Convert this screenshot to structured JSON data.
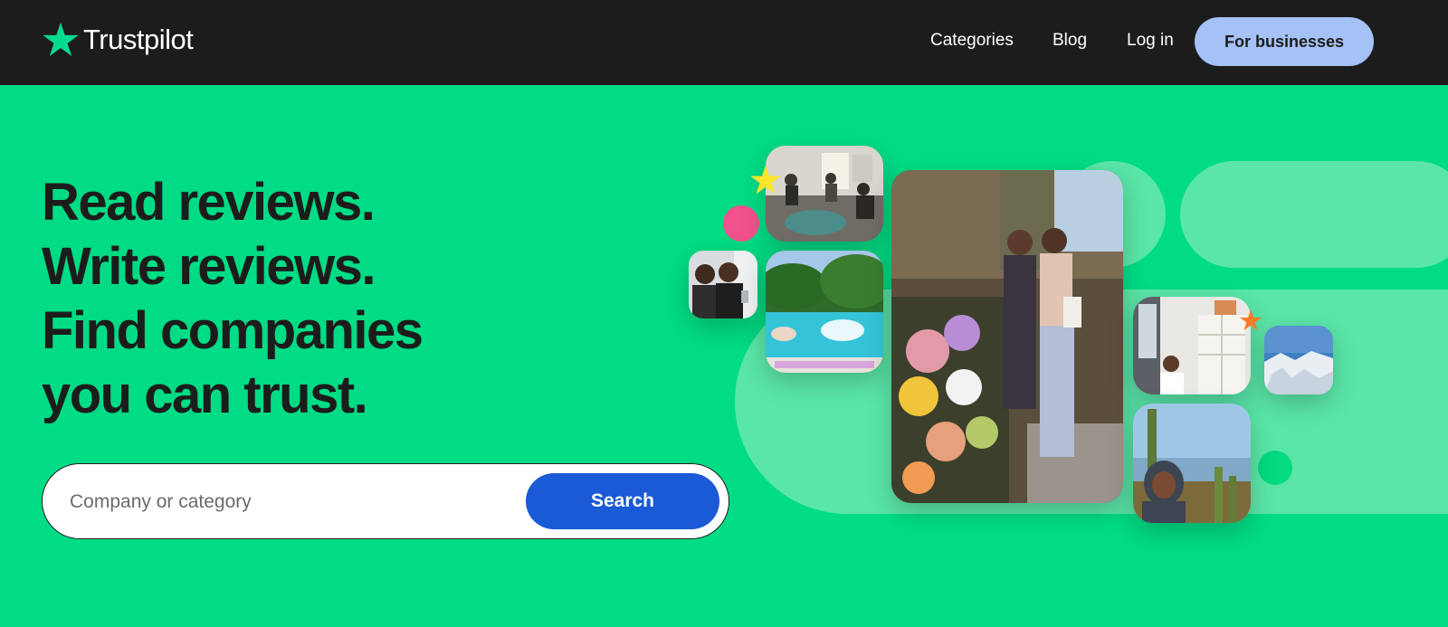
{
  "header": {
    "logo_text": "Trustpilot",
    "nav": {
      "categories": "Categories",
      "blog": "Blog",
      "login": "Log in"
    },
    "for_businesses": "For businesses"
  },
  "hero": {
    "headline": [
      "Read reviews.",
      "Write reviews.",
      "Find companies",
      "you can trust."
    ],
    "search": {
      "placeholder": "Company or category",
      "button": "Search"
    }
  },
  "colors": {
    "background": "#00dc85",
    "header": "#1c1c1c",
    "brand_star": "#04da8d",
    "business_button": "#a5c2f7",
    "search_button": "#1b5ad6",
    "accent_pink": "#f2528c",
    "accent_yellow": "#ffe52a",
    "accent_orange": "#ff7a2a"
  },
  "icons": [
    "trustpilot-star-logo",
    "yellow-star",
    "orange-star"
  ]
}
